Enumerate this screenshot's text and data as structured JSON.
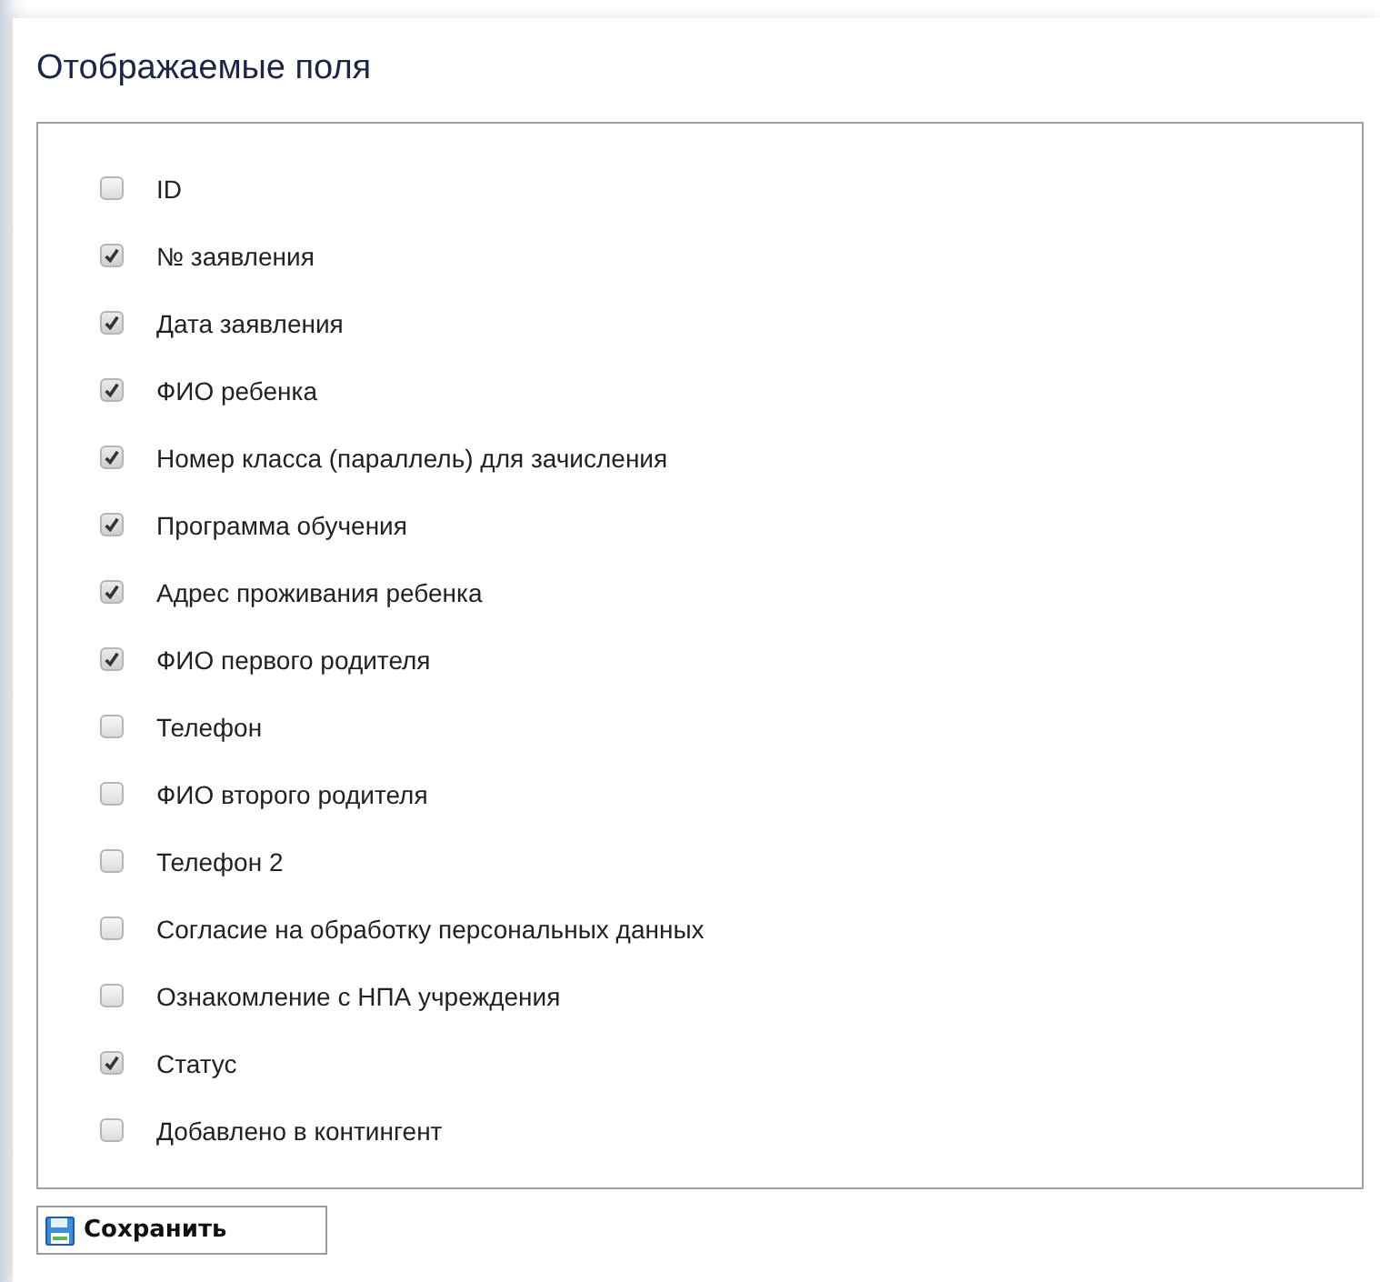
{
  "title": "Отображаемые поля",
  "fields": [
    {
      "label": "ID",
      "checked": false
    },
    {
      "label": "№ заявления",
      "checked": true
    },
    {
      "label": "Дата заявления",
      "checked": true
    },
    {
      "label": "ФИО ребенка",
      "checked": true
    },
    {
      "label": "Номер класса (параллель) для зачисления",
      "checked": true
    },
    {
      "label": "Программа обучения",
      "checked": true
    },
    {
      "label": "Адрес проживания ребенка",
      "checked": true
    },
    {
      "label": "ФИО первого родителя",
      "checked": true
    },
    {
      "label": "Телефон",
      "checked": false
    },
    {
      "label": "ФИО второго родителя",
      "checked": false
    },
    {
      "label": "Телефон 2",
      "checked": false
    },
    {
      "label": "Согласие на обработку персональных данных",
      "checked": false
    },
    {
      "label": "Ознакомление с НПА учреждения",
      "checked": false
    },
    {
      "label": "Статус",
      "checked": true
    },
    {
      "label": "Добавлено в контингент",
      "checked": false
    }
  ],
  "save_button": "Сохранить"
}
